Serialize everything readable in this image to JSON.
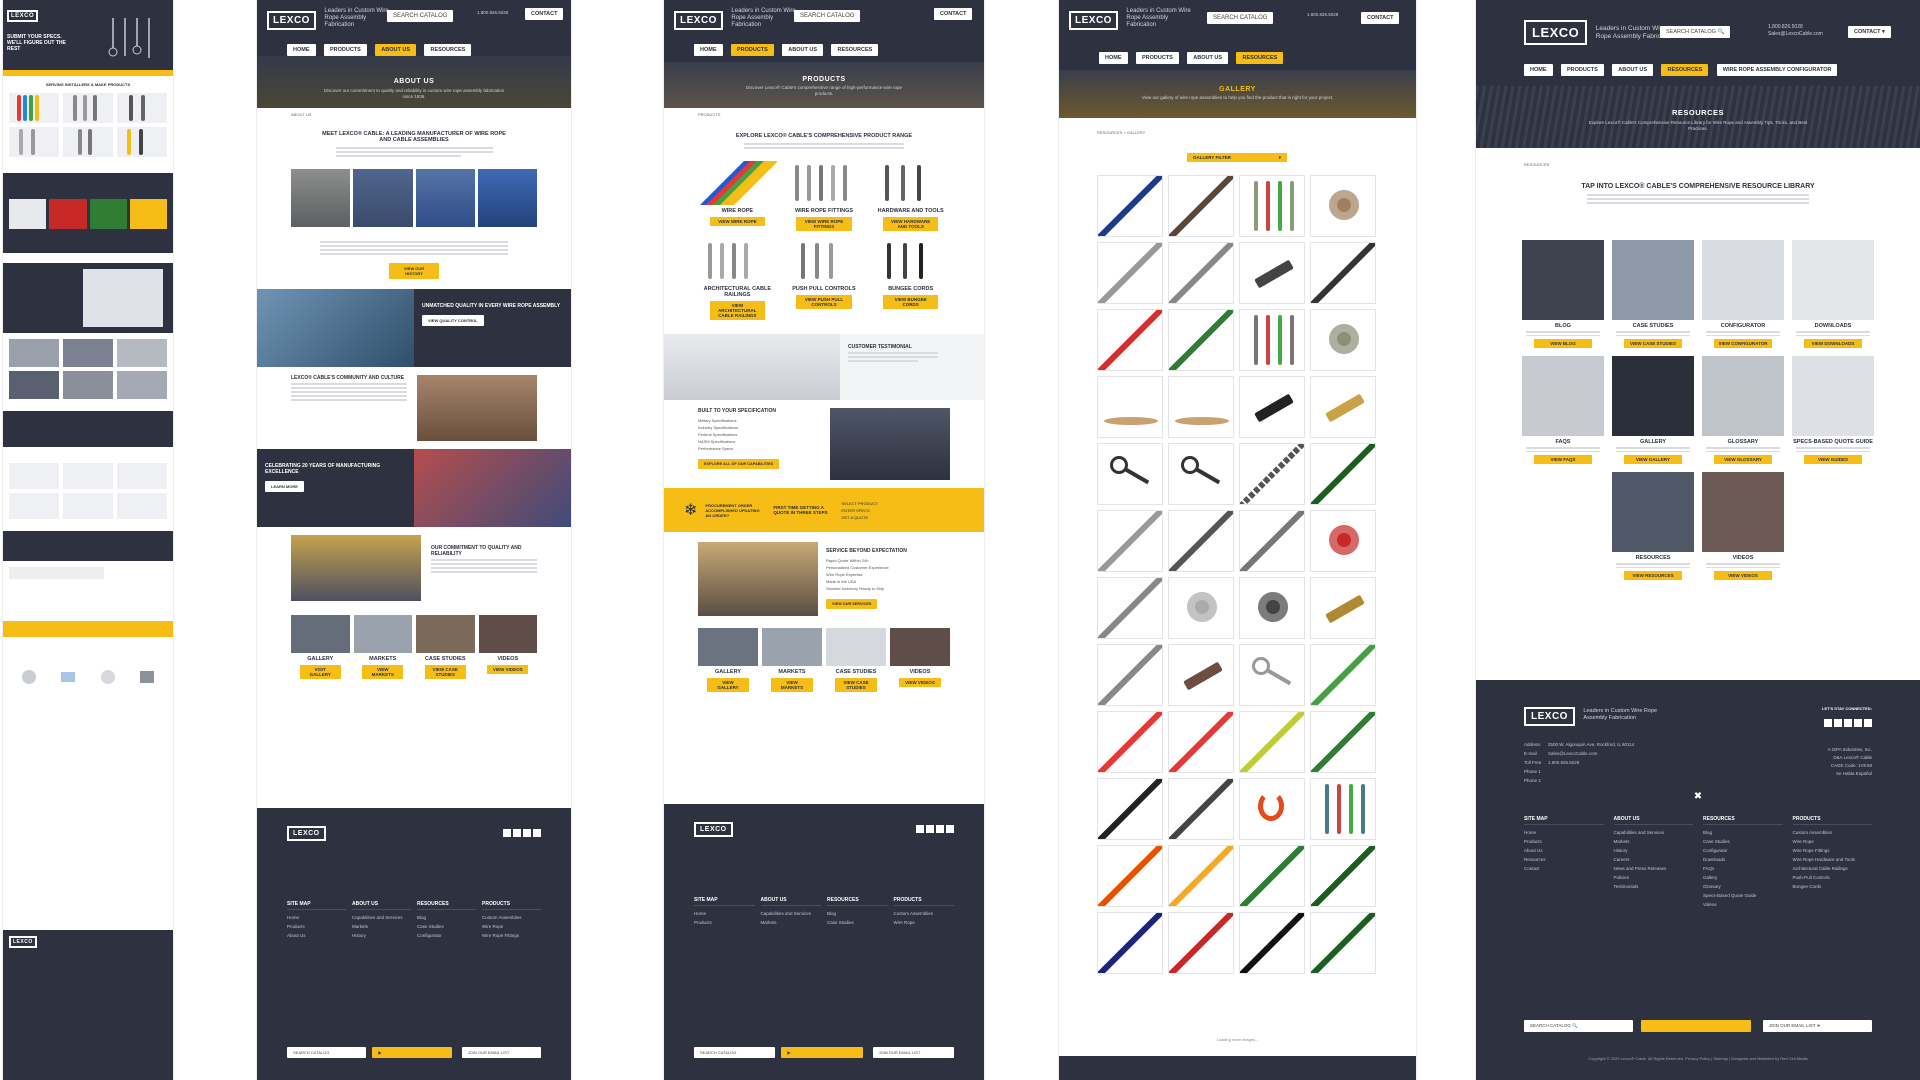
{
  "common": {
    "logo_text": "LEXCO",
    "tagline": "Leaders in Custom Wire Rope Assembly Fabrication",
    "search_label": "SEARCH CATALOG",
    "phone": "1.800.826.5028",
    "email": "Sales@LexcoCable.com",
    "contact_label": "CONTACT",
    "nav": [
      "HOME",
      "PRODUCTS",
      "ABOUT US",
      "RESOURCES",
      "WIRE ROPE ASSEMBLY CONFIGURATOR"
    ],
    "accent_yellow": "#f6bd16",
    "navy": "#2d3140",
    "footer": {
      "columns": [
        {
          "head": "SITE MAP",
          "links": [
            "Home",
            "Products",
            "About Us",
            "Resources",
            "Contact"
          ]
        },
        {
          "head": "ABOUT US",
          "links": [
            "Capabilities and Services",
            "Markets",
            "History",
            "Careers",
            "News and Press Releases",
            "Policies",
            "Testimonials"
          ]
        },
        {
          "head": "RESOURCES",
          "links": [
            "Blog",
            "Case Studies",
            "Configurator",
            "Downloads",
            "FAQs",
            "Gallery",
            "Glossary",
            "Specs-Based Quote Guide",
            "Videos"
          ]
        },
        {
          "head": "PRODUCTS",
          "links": [
            "Custom Assemblies",
            "Wire Rope",
            "Wire Rope Fittings",
            "Wire Rope Hardware and Tools",
            "Architectural Cable Railings",
            "Push-Pull Controls",
            "Bungee Cords"
          ]
        }
      ],
      "address_label": "Address",
      "address": "2500 W. Algonquin Ave, Rockford, IL 60114",
      "email_label": "E-mail",
      "tollfree_label": "Toll Free",
      "phone1_label": "Phone 1",
      "phone2_label": "Phone 2",
      "connect_label": "LET'S STAY CONNECTED:",
      "company": [
        "A ISPA Industries, Inc.",
        "D&A Lexco® Cable",
        "CAGE Code: 1VKS8",
        "Se Habla Español"
      ],
      "search_label": "SEARCH CATALOG",
      "newsletter_label": "JOIN OUR EMAIL LIST",
      "copyright": "Copyright © 2025 Lexco® Cable. All Rights Reserved. Privacy Policy | Sitemap | Designed and Marketed by Red Cell Media"
    }
  },
  "about": {
    "hero_title": "ABOUT US",
    "hero_text": "Discover our commitment to quality and reliability in custom wire rope assembly fabrication since 1936.",
    "breadcrumb": "ABOUT US",
    "heading": "MEET LEXCO® CABLE: A LEADING MANUFACTURER OF WIRE ROPE AND CABLE ASSEMBLIES",
    "cta": "VIEW OUR HISTORY",
    "banner1_title": "UNMATCHED QUALITY IN EVERY WIRE ROPE ASSEMBLY",
    "banner1_btn": "VIEW QUALITY CONTROL",
    "community_title": "LEXCO® CABLE'S COMMUNITY AND CULTURE",
    "banner2_title": "CELEBRATING 20 YEARS OF MANUFACTURING EXCELLENCE",
    "banner2_btn": "LEARN MORE",
    "commit_title": "OUR COMMITMENT TO QUALITY AND RELIABILITY",
    "cards": [
      {
        "title": "GALLERY",
        "btn": "VISIT GALLERY"
      },
      {
        "title": "MARKETS",
        "btn": "VIEW MARKETS"
      },
      {
        "title": "CASE STUDIES",
        "btn": "VIEW CASE STUDIES"
      },
      {
        "title": "VIDEOS",
        "btn": "VIEW VIDEOS"
      }
    ]
  },
  "products": {
    "hero_title": "PRODUCTS",
    "hero_text": "Discover Lexco® Cable's comprehensive range of high-performance wire rope products.",
    "breadcrumb": "PRODUCTS",
    "heading": "EXPLORE LEXCO® CABLE'S COMPREHENSIVE PRODUCT RANGE",
    "items": [
      {
        "title": "WIRE ROPE",
        "btn": "VIEW WIRE ROPE"
      },
      {
        "title": "WIRE ROPE FITTINGS",
        "btn": "VIEW WIRE ROPE FITTINGS"
      },
      {
        "title": "HARDWARE AND TOOLS",
        "btn": "VIEW HARDWARE AND TOOLS"
      },
      {
        "title": "ARCHITECTURAL CABLE RAILINGS",
        "btn": "VIEW ARCHITECTURAL CABLE RAILINGS"
      },
      {
        "title": "PUSH PULL CONTROLS",
        "btn": "VIEW PUSH PULL CONTROLS"
      },
      {
        "title": "BUNGEE CORDS",
        "btn": "VIEW BUNGEE CORDS"
      }
    ],
    "testimonial_title": "CUSTOMER TESTIMONIAL",
    "spec_title": "BUILT TO YOUR SPECIFICATION",
    "spec_items": [
      "Military Specifications",
      "Industry Specifications",
      "Federal Specifications",
      "NASM Specifications",
      "Performance Specs"
    ],
    "spec_btn": "EXPLORE ALL OF OUR CAPABILITIES",
    "yellow_left": "PROCUREMENT ORDER ACCOMPLISHED UPDATING AN ORDER?",
    "yellow_mid": "FIRST TIME GETTING A QUOTE IN THREE STEPS",
    "yellow_steps": [
      "SELECT PRODUCT",
      "ENTER SPECS",
      "GET A QUOTE"
    ],
    "service_title": "SERVICE BEYOND EXPECTATION",
    "service_items": [
      "Rapid Quote Within 24h",
      "Personalized Customer Experience",
      "Wire Rope Expertise",
      "Made in the USA",
      "Stocked Inventory Ready to Ship"
    ],
    "service_btn": "VIEW OUR SERVICES",
    "cards": [
      {
        "title": "GALLERY",
        "btn": "VIEW GALLERY"
      },
      {
        "title": "MARKETS",
        "btn": "VIEW MARKETS"
      },
      {
        "title": "CASE STUDIES",
        "btn": "VIEW CASE STUDIES"
      },
      {
        "title": "VIDEOS",
        "btn": "VIEW VIDEOS"
      }
    ]
  },
  "gallery": {
    "hero_title": "GALLERY",
    "hero_text": "View our gallery of wire rope assemblies to help you find the product that is right for your project.",
    "breadcrumb": "RESOURCES > GALLERY",
    "filter": "GALLERY FILTER",
    "footer_note": "Loading more images..."
  },
  "resources": {
    "hero_title": "RESOURCES",
    "hero_text": "Explore Lexco® Cable's Comprehensive Resource Library for Wire Rope and Assembly Tips, Tricks, and Best Practices.",
    "breadcrumb": "RESOURCES",
    "heading": "TAP INTO LEXCO® CABLE'S COMPREHENSIVE RESOURCE LIBRARY",
    "items": [
      {
        "title": "BLOG",
        "btn": "VIEW BLOG"
      },
      {
        "title": "CASE STUDIES",
        "btn": "VIEW CASE STUDIES"
      },
      {
        "title": "CONFIGURATOR",
        "btn": "VIEW CONFIGURATOR"
      },
      {
        "title": "DOWNLOADS",
        "btn": "VIEW DOWNLOADS"
      },
      {
        "title": "FAQS",
        "btn": "VIEW FAQS"
      },
      {
        "title": "GALLERY",
        "btn": "VIEW GALLERY"
      },
      {
        "title": "GLOSSARY",
        "btn": "VIEW GLOSSARY"
      },
      {
        "title": "SPECS-BASED QUOTE GUIDE",
        "btn": "VIEW GUIDES"
      },
      {
        "title": "RESOURCES",
        "btn": "VIEW RESOURCES"
      },
      {
        "title": "VIDEOS",
        "btn": "VIEW VIDEOS"
      }
    ]
  },
  "home": {
    "hero_title": "SUBMIT YOUR SPECS. WE'LL FIGURE OUT THE REST",
    "section1": "SERVING INSTALLERS & MAKE PRODUCTS"
  }
}
